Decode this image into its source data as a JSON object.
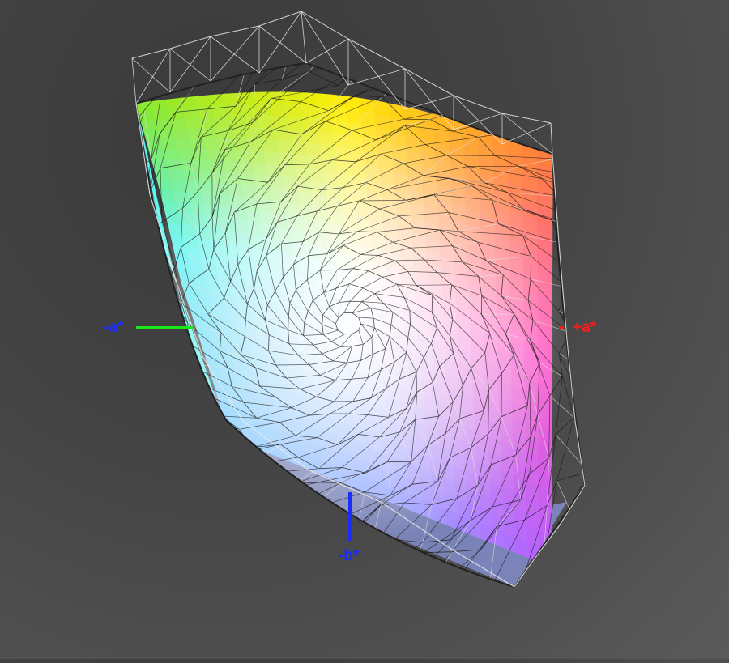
{
  "axes": {
    "neg_a": {
      "label": "-a*",
      "color": "#1a2cff",
      "line_color": "#19e619"
    },
    "pos_a": {
      "label": "+a*",
      "color": "#ff1a1a",
      "line_color": "#ff1a1a"
    },
    "neg_b": {
      "label": "-b*",
      "color": "#1a2cff",
      "line_color": "#1a2cff"
    }
  },
  "surface_colors": {
    "top_left": "#86e82a",
    "top_center": "#ffee00",
    "top_right": "#ff7a3c",
    "center": "#ffffff",
    "left": "#5cf4f0",
    "right": "#ff5ac8",
    "bottom_left": "#7cc8ff",
    "bottom_center": "#9aa8ff",
    "bottom_right": "#b45cff"
  },
  "background_color": "#4a4a4a"
}
